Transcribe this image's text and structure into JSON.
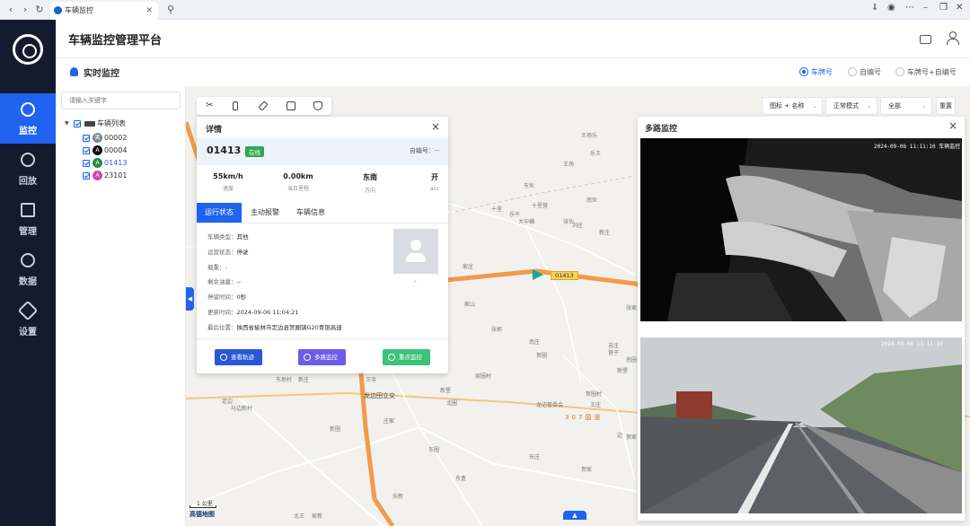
{
  "browser": {
    "tab_title": "车辆监控"
  },
  "sidebar": {
    "items": [
      {
        "label": "监控",
        "icon": "monitor-icon"
      },
      {
        "label": "回放",
        "icon": "playback-icon"
      },
      {
        "label": "管理",
        "icon": "manage-icon"
      },
      {
        "label": "数据",
        "icon": "data-icon"
      },
      {
        "label": "设置",
        "icon": "settings-icon"
      }
    ],
    "active_index": 0
  },
  "header": {
    "title": "车辆监控管理平台"
  },
  "subheader": {
    "title": "实时监控",
    "radio_options": [
      "车牌号",
      "自编号",
      "车牌号+自编号"
    ],
    "selected_radio": 0
  },
  "tree": {
    "search_placeholder": "请输入关键字",
    "root_label": "车辆列表",
    "vehicles": [
      {
        "plate": "00002",
        "color": "#7b8592",
        "mark": "离"
      },
      {
        "plate": "00004",
        "color": "#111111",
        "mark": "A"
      },
      {
        "plate": "01413",
        "color": "#2c8a3c",
        "mark": "A"
      },
      {
        "plate": "23101",
        "color": "#d846a6",
        "mark": "A"
      }
    ]
  },
  "map_controls": {
    "display_select": "图标 + 名称",
    "mode_select": "正常模式",
    "filter_select": "全部",
    "reset_label": "重置"
  },
  "detail": {
    "title": "详情",
    "plate": "01413",
    "status": "在线",
    "self_number": "自编号：--",
    "stats": [
      {
        "value": "55km/h",
        "label": "速度"
      },
      {
        "value": "0.00km",
        "label": "当日里程"
      },
      {
        "value": "东南",
        "label": "方向"
      },
      {
        "value": "开",
        "label": "acc"
      }
    ],
    "tabs": [
      "运行状态",
      "主动报警",
      "车辆信息"
    ],
    "active_tab": 0,
    "info": [
      {
        "label": "车辆类型：",
        "value": "其他"
      },
      {
        "label": "运营状态：",
        "value": "停驶"
      },
      {
        "label": "载重：",
        "value": "-"
      },
      {
        "label": "剩余油量：",
        "value": "--"
      },
      {
        "label": "停留时间：",
        "value": "0秒"
      },
      {
        "label": "更新时间：",
        "value": "2024-09-06 11:04:21"
      },
      {
        "label": "最后位置：",
        "value": "陕西省榆林市定边县贺圈镇G20青银高速"
      }
    ],
    "avatar_caption": "-",
    "actions": [
      {
        "label": "查看轨迹",
        "color": "#2a56d8"
      },
      {
        "label": "多路监控",
        "color": "#6d5ce8"
      },
      {
        "label": "重点监控",
        "color": "#3cc27a"
      }
    ]
  },
  "map": {
    "vehicle_label": "01413",
    "road_label": "307国道",
    "places": [
      "王场乐",
      "乐王",
      "王场",
      "冬至",
      "乐新村",
      "乐干",
      "十里",
      "大中横",
      "张伙",
      "十里营",
      "南伙",
      "东伙",
      "张家场",
      "刘庄",
      "新庄",
      "家庄",
      "家山",
      "张郭",
      "南庄",
      "吉庄",
      "贺圈",
      "新堡",
      "龙边管委会",
      "定边",
      "东地村",
      "新庄",
      "庄家",
      "新圈",
      "北圈",
      "新堡",
      "王寺",
      "东庄",
      "贺家",
      "东盒",
      "乐新",
      "王庄",
      "边",
      "东圈",
      "贺圈村",
      "乐新",
      "北王",
      "家新",
      "马边新村",
      "家圈村",
      "营子",
      "贺家",
      "南圈"
    ],
    "town_label": "龙边田立交",
    "scale_label": "1 公里",
    "logo": "高德地图"
  },
  "videos": {
    "title": "多路监控",
    "timestamps": [
      "2024-09-06 11:11:10 车辆监控",
      "2024-09-06 11:11:10"
    ]
  }
}
